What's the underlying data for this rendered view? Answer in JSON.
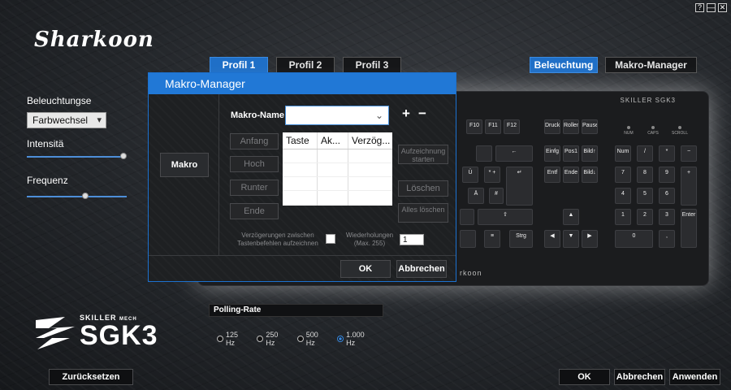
{
  "window": {
    "help": "?",
    "minimize": "—",
    "close": "✕"
  },
  "brand": {
    "name": "Sharkoon"
  },
  "profile_tabs": [
    {
      "label": "Profil 1",
      "active": true
    },
    {
      "label": "Profil 2",
      "active": false
    },
    {
      "label": "Profil 3",
      "active": false
    }
  ],
  "mode_tabs": [
    {
      "label": "Beleuchtung",
      "active": true
    },
    {
      "label": "Makro-Manager",
      "active": false
    }
  ],
  "lighting": {
    "title": "Beleuchtungse",
    "mode_value": "Farbwechsel",
    "intensity_label": "Intensitä",
    "intensity_level": 1.0,
    "frequency_label": "Frequenz",
    "frequency_level": 0.6
  },
  "keyboard": {
    "logo": "SKILLER SGK3",
    "footer_logo": "rkoon",
    "leds": [
      "NUM",
      "CAPS",
      "SCROLL"
    ],
    "keys": {
      "f9": "F10",
      "f11": "F11",
      "f12": "F12",
      "print": "Druck",
      "rollen": "Rollen",
      "pause": "Pause",
      "num": "Num",
      "div": "/",
      "mul": "*",
      "minus": "−",
      "backspace": "←",
      "ins": "Einfg",
      "pos1": "Pos1",
      "bildup": "Bild↑",
      "n7": "7",
      "n8": "8",
      "n9": "9",
      "plus": "+",
      "ue": "Ü",
      "star": "* +",
      "enter": "↵",
      "entf": "Entf",
      "ende": "Ende",
      "bilddown": "Bild↓",
      "n4": "4",
      "n5": "5",
      "n6": "6",
      "ae": "Ä",
      "hash": "#",
      "shift": "⇧",
      "up": "▲",
      "n1": "1",
      "n2": "2",
      "n3": "3",
      "nenter": "Enter",
      "fn": "Fn",
      "menu": "≡",
      "strg": "Strg",
      "left": "◀",
      "down": "▼",
      "right": "▶",
      "n0": "0",
      "ndel": ","
    }
  },
  "polling": {
    "title": "Polling-Rate",
    "options": [
      {
        "label": "125 Hz",
        "selected": false
      },
      {
        "label": "250 Hz",
        "selected": false
      },
      {
        "label": "500 Hz",
        "selected": false
      },
      {
        "label": "1.000 Hz",
        "selected": true
      }
    ]
  },
  "product": {
    "line": "SKILLER",
    "model": "SGK3",
    "badge": "MECH"
  },
  "footer": {
    "reset": "Zurücksetzen",
    "ok": "OK",
    "cancel": "Abbrechen",
    "apply": "Anwenden"
  },
  "dialog": {
    "title": "Makro-Manager",
    "side_button": "Makro",
    "name_label": "Makro-Name",
    "name_value": "",
    "add": "+",
    "remove": "−",
    "columns": [
      "Taste",
      "Ak...",
      "Verzög..."
    ],
    "left_buttons": [
      "Anfang",
      "Hoch",
      "Runter",
      "Ende"
    ],
    "right_buttons": [
      "Aufzeichnung starten",
      "Löschen",
      "Alles löschen"
    ],
    "delay_label": "Verzögerungen zwischen Tastenbefehlen aufzeichnen",
    "repeat_label": "Wiederholungen (Max. 255)",
    "repeat_value": "1",
    "ok": "OK",
    "cancel": "Abbrechen"
  }
}
